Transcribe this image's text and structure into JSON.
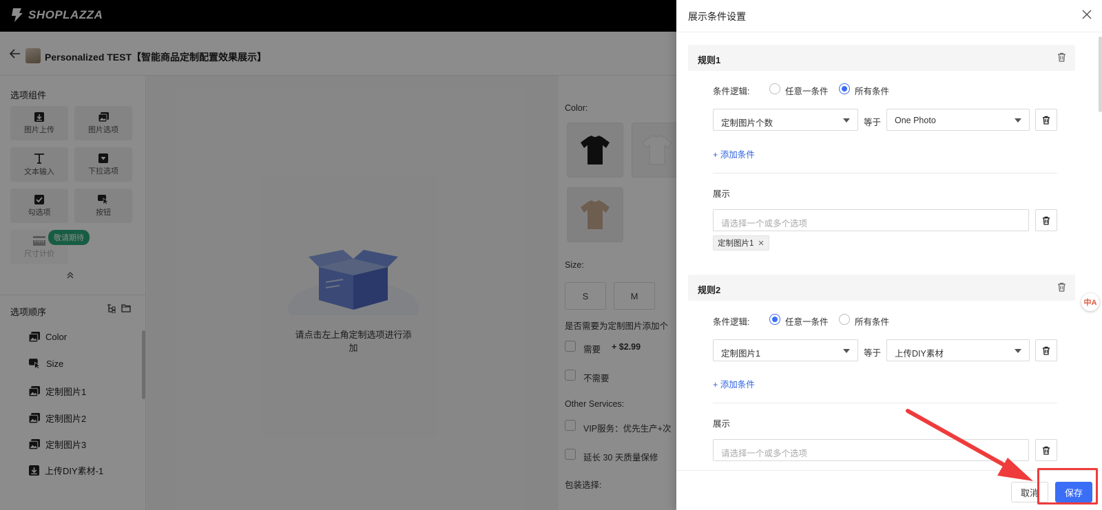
{
  "topbar": {
    "logo_text": "SHOPLAZZA"
  },
  "header": {
    "product_title": "Personalized TEST【智能商品定制配置效果展示】"
  },
  "left_panel": {
    "components_title": "选项组件",
    "components": [
      {
        "label": "图片上传",
        "icon": "upload-icon"
      },
      {
        "label": "图片选项",
        "icon": "image-icon"
      },
      {
        "label": "文本输入",
        "icon": "text-icon"
      },
      {
        "label": "下拉选项",
        "icon": "dropdown-icon"
      },
      {
        "label": "勾选项",
        "icon": "checkbox-icon"
      },
      {
        "label": "按钮",
        "icon": "cursor-icon"
      },
      {
        "label": "尺寸计价",
        "icon": "ruler-icon"
      }
    ],
    "coming_soon_badge": "敬请期待",
    "order_title": "选项顺序",
    "order_items": [
      {
        "label": "Color",
        "icon": "image-icon"
      },
      {
        "label": "Size",
        "icon": "cursor-icon"
      },
      {
        "label": "定制图片1",
        "icon": "image-icon"
      },
      {
        "label": "定制图片2",
        "icon": "image-icon"
      },
      {
        "label": "定制图片3",
        "icon": "image-icon"
      },
      {
        "label": "上传DIY素材-1",
        "icon": "upload-icon"
      }
    ]
  },
  "canvas": {
    "empty_text": "请点击左上角定制选项进行添加"
  },
  "preview": {
    "color_label": "Color:",
    "size_label": "Size:",
    "sizes": [
      "S",
      "M"
    ],
    "photo_question": "是否需要为定制图片添加个",
    "photo_options": [
      {
        "label": "需要",
        "price": "+ $2.99"
      },
      {
        "label": "不需要",
        "price": ""
      }
    ],
    "other_label": "Other Services:",
    "other_options": [
      "VIP服务：优先生产+次",
      "延长 30 天质量保修"
    ],
    "packaging_label": "包装选择:"
  },
  "drawer": {
    "title": "展示条件设置",
    "logic_label": "条件逻辑:",
    "logic_any": "任意一条件",
    "logic_all": "所有条件",
    "equals": "等于",
    "add_condition": "+ 添加条件",
    "show_label": "展示",
    "show_placeholder": "请选择一个或多个选项",
    "rules": [
      {
        "name": "规则1",
        "logic_selected": "all",
        "field": "定制图片个数",
        "value": "One Photo",
        "tags": [
          "定制图片1"
        ]
      },
      {
        "name": "规则2",
        "logic_selected": "any",
        "field": "定制图片1",
        "value": "上传DIY素材",
        "tags": []
      }
    ],
    "cancel_label": "取消",
    "save_label": "保存"
  },
  "translate_badge": "中A",
  "colors": {
    "primary": "#3b6ef6",
    "link": "#2f62e3",
    "annotation": "#ef3b3b",
    "badge": "#2aa97a"
  }
}
